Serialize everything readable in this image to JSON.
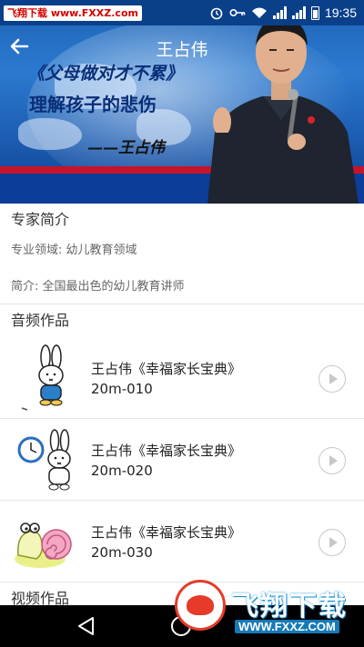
{
  "status_bar": {
    "watermark_text": "飞翔下载 www.FXXZ.com",
    "time": "19:35"
  },
  "app_bar": {
    "title": "王占伟",
    "back_icon": "arrow-left-icon"
  },
  "banner": {
    "slogan_line1": "《父母做对才不累》",
    "slogan_line2": "理解孩子的悲伤",
    "signature": "——王占伟"
  },
  "intro": {
    "section_title": "专家简介",
    "field_line": "专业领域: 幼儿教育领域",
    "bio_line": "简介: 全国最出色的幼儿教育讲师"
  },
  "audio": {
    "section_title": "音频作品",
    "tracks": [
      {
        "title": "王占伟《幸福家长宝典》",
        "subtitle": "20m-010",
        "thumb_icon": "bunny-boy-icon"
      },
      {
        "title": "王占伟《幸福家长宝典》",
        "subtitle": "20m-020",
        "thumb_icon": "bunny-clock-icon"
      },
      {
        "title": "王占伟《幸福家长宝典》",
        "subtitle": "20m-030",
        "thumb_icon": "snail-icon"
      }
    ]
  },
  "video": {
    "section_title": "视频作品"
  },
  "footer_watermark": {
    "name": "飞翔下载",
    "url": "WWW.FXXZ.COM"
  },
  "colors": {
    "status_bar": "#0a3f8a",
    "banner_blue": "#1d62b5",
    "accent_red": "#c8142a",
    "text_primary": "#222222",
    "text_secondary": "#666666"
  }
}
